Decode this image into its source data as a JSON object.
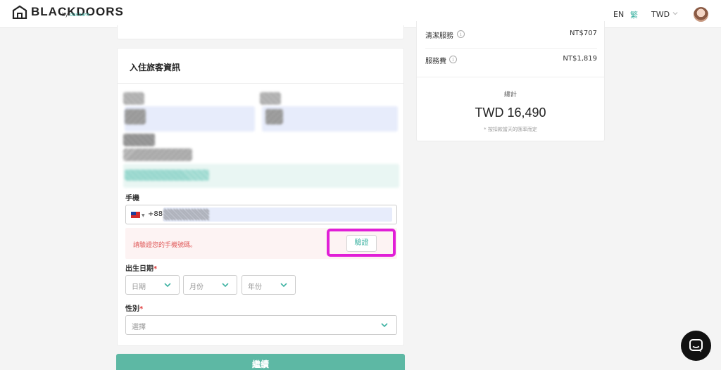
{
  "header": {
    "brand": "BLACKDOORS",
    "brand_sub_prefix": "by ",
    "brand_sub_name": "dashare",
    "lang_en": "EN",
    "lang_zh": "繁",
    "currency": "TWD"
  },
  "guest_form": {
    "title": "入住旅客資訊",
    "phone_label": "手機",
    "phone_code": "+886",
    "verify_message": "請驗證您的手機號碼。",
    "verify_button": "驗證",
    "birthdate_label": "出生日期",
    "required_mark": "*",
    "day_placeholder": "日期",
    "month_placeholder": "月份",
    "year_placeholder": "年份",
    "gender_label": "性別",
    "gender_placeholder": "選擇",
    "continue_button": "繼續"
  },
  "price_summary": {
    "rows": [
      {
        "label": "清潔服務",
        "value": "NT$707"
      },
      {
        "label": "服務費",
        "value": "NT$1,819"
      }
    ],
    "total_label": "總計",
    "total_value": "TWD 16,490",
    "total_note": "* 按扣款當天的匯率而定"
  },
  "colors": {
    "accent": "#3fb3a3",
    "continue_bg": "#5db8a4",
    "highlight": "#e11fd7",
    "error_text": "#e05a5a"
  },
  "icons": {
    "logo": "house-logo-icon",
    "currency_dropdown": "chevron-down-icon",
    "info": "info-icon",
    "select_dropdown": "chevron-down-icon",
    "chat": "chat-icon"
  }
}
